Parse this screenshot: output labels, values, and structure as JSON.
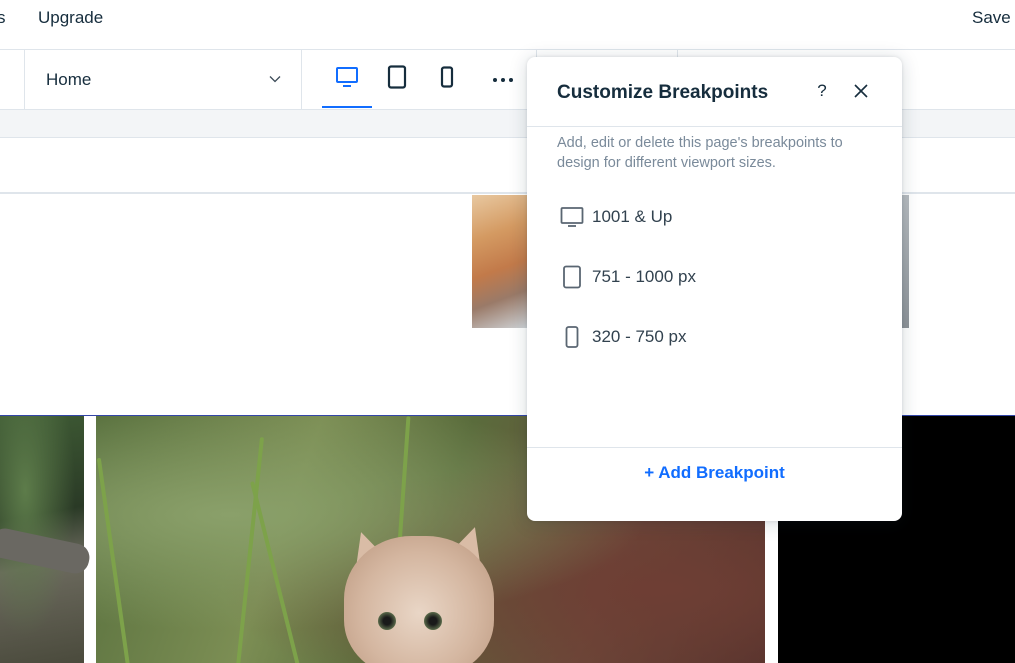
{
  "top_bar": {
    "cut_text": "s",
    "upgrade_label": "Upgrade",
    "save_label": "Save"
  },
  "toolbar": {
    "page_select_value": "Home",
    "devices": [
      {
        "name": "desktop",
        "icon": "desktop-icon",
        "active": true
      },
      {
        "name": "tablet",
        "icon": "tablet-icon",
        "active": false
      },
      {
        "name": "mobile",
        "icon": "mobile-icon",
        "active": false
      }
    ],
    "more_icon": "more-horizontal-icon"
  },
  "panel": {
    "title": "Customize Breakpoints",
    "help_label": "?",
    "description": "Add, edit or delete this page's breakpoints to design for different viewport sizes.",
    "breakpoints": [
      {
        "icon": "desktop-icon",
        "label": "1001 & Up"
      },
      {
        "icon": "tablet-icon",
        "label": "751 - 1000 px"
      },
      {
        "icon": "mobile-icon",
        "label": "320 - 750 px"
      }
    ],
    "add_label": "+ Add Breakpoint"
  },
  "colors": {
    "accent": "#116dff",
    "text": "#162d3d",
    "muted": "#7a8a9a",
    "guide": "#3346a8"
  }
}
